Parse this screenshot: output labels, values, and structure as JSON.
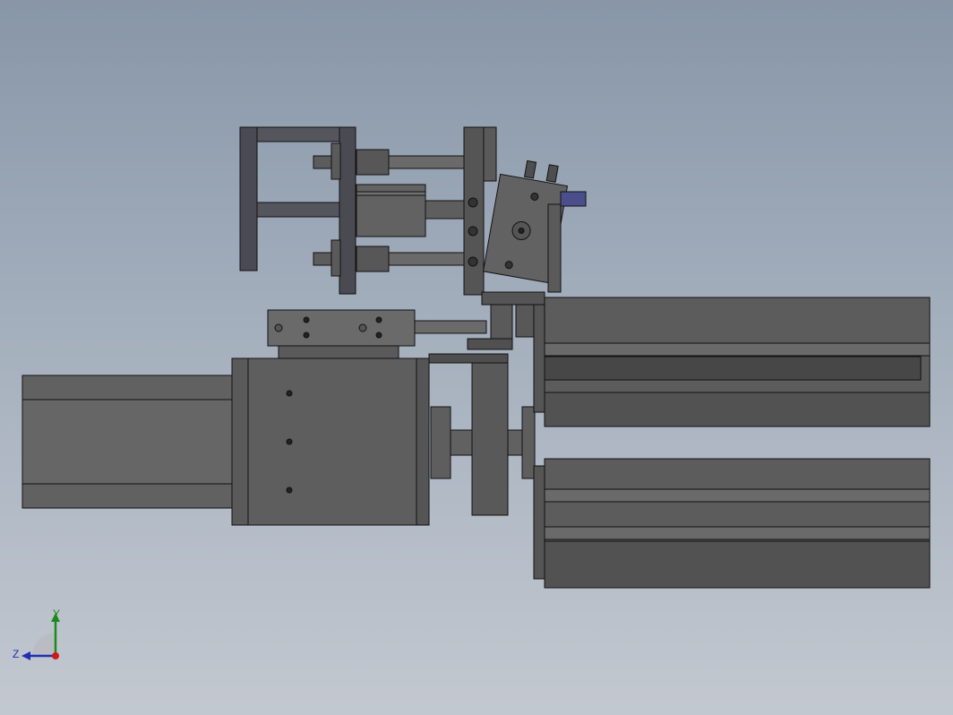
{
  "viewport": {
    "background_top": "#8796a8",
    "background_bottom": "#c3c8d0",
    "part_fill": "#5f5f5f",
    "part_fill_dark": "#4a4a4a",
    "part_fill_light": "#6e6e6e",
    "edge_color": "#111111",
    "accent_blue": "#4a4f8c"
  },
  "triad": {
    "y_label": "Y",
    "z_label": "Z",
    "y_color": "#1a8a1a",
    "z_color": "#2030b0",
    "origin_color": "#d01818"
  }
}
